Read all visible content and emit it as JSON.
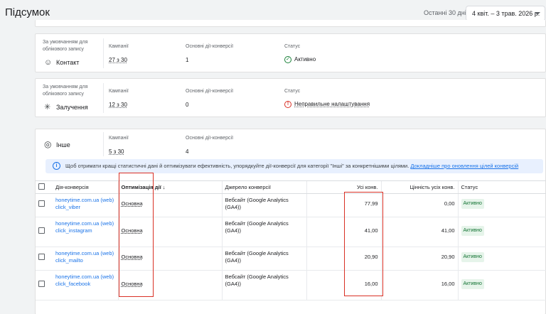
{
  "header": {
    "title": "Підсумок",
    "range_label": "Останні 30 днів",
    "date_range": "4 квіт. – 3 трав. 2026 р."
  },
  "common": {
    "default_tag": "За умовчанням для облікового запису",
    "campaigns_label": "Кампанії",
    "primary_label": "Основні дії-конверсії",
    "status_label": "Статус"
  },
  "categories": [
    {
      "name": "Контакт",
      "icon": "contacts-icon",
      "campaigns": "27 з 30",
      "primary": "1",
      "status": "Активно"
    },
    {
      "name": "Залучення",
      "icon": "engagement-icon",
      "campaigns": "12 з 30",
      "primary": "0",
      "status": "Неправильне налаштування"
    },
    {
      "name": "Інше",
      "icon": "other-icon",
      "campaigns": "5 з 30",
      "primary": "4"
    }
  ],
  "info": {
    "text": "Щоб отримати кращі статистичні дані й оптимізувати ефективність, упорядкуйте дії-конверсії для категорії \"Інші\" за конкретнішими цілями.",
    "link": "Докладніше про оновлення цілей конверсій"
  },
  "table": {
    "headers": [
      "Дія-конверсія",
      "Оптимізація дії",
      "Джерело конверсії",
      "Усі конв.",
      "Цінність усіх конв.",
      "Статус"
    ],
    "rows": [
      {
        "name": "honeytime.com.ua (web) click_viber",
        "optimization": "Основна",
        "source": "Вебсайт (Google Analytics (GA4))",
        "all_conv": "77,99",
        "value": "0,00",
        "status": "Активно"
      },
      {
        "name": "honeytime.com.ua (web) click_instagram",
        "optimization": "Основна",
        "source": "Вебсайт (Google Analytics (GA4))",
        "all_conv": "41,00",
        "value": "41,00",
        "status": "Активно"
      },
      {
        "name": "honeytime.com.ua (web) click_mailto",
        "optimization": "Основна",
        "source": "Вебсайт (Google Analytics (GA4))",
        "all_conv": "20,90",
        "value": "20,90",
        "status": "Активно"
      },
      {
        "name": "honeytime.com.ua (web) click_facebook",
        "optimization": "Основна",
        "source": "Вебсайт (Google Analytics (GA4))",
        "all_conv": "16,00",
        "value": "16,00",
        "status": "Активно"
      }
    ]
  },
  "colors": {
    "accent": "#1a73e8",
    "ok": "#188038",
    "error": "#d93025",
    "highlight": "#d93025"
  }
}
